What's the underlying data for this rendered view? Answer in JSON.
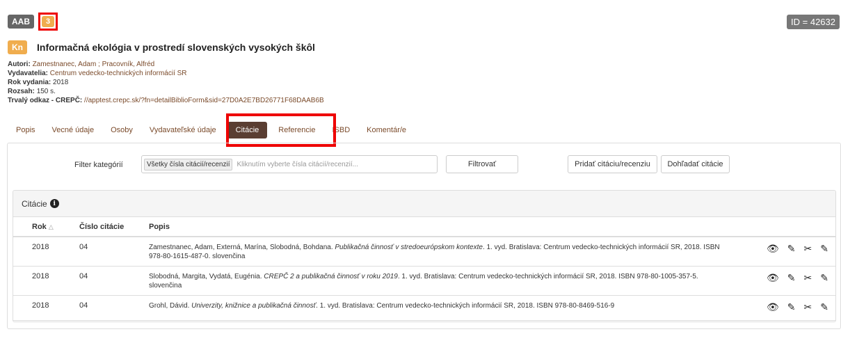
{
  "header": {
    "code_badge": "AAB",
    "count_badge": "3",
    "id_label": "ID = 42632",
    "type_badge": "Kn",
    "title": "Informačná ekológia v prostredí slovenských vysokých škôl"
  },
  "meta": {
    "authors_label": "Autori:",
    "authors": "Zamestnanec, Adam ; Pracovník, Alfréd",
    "publishers_label": "Vydavatelia:",
    "publishers": "Centrum vedecko-technických informácií SR",
    "year_label": "Rok vydania:",
    "year": "2018",
    "extent_label": "Rozsah:",
    "extent": "150 s.",
    "link_label": "Trvalý odkaz - CREPČ:",
    "link": "//apptest.crepc.sk/?fn=detailBiblioForm&sid=27D0A2E7BD26771F68DAAB6B"
  },
  "tabs": [
    {
      "label": "Popis"
    },
    {
      "label": "Vecné údaje"
    },
    {
      "label": "Osoby"
    },
    {
      "label": "Vydavateľské údaje"
    },
    {
      "label": "Citácie"
    },
    {
      "label": "Referencie"
    },
    {
      "label": "ISBD"
    },
    {
      "label": "Komentár/e"
    }
  ],
  "filter": {
    "label": "Filter kategórií",
    "chip": "Všetky čísla citácií/recenzií",
    "placeholder": "Kliknutím vyberte čísla citácií/recenzií...",
    "filter_button": "Filtrovať",
    "add_button": "Pridať citáciu/recenziu",
    "find_button": "Dohľadať citácie"
  },
  "citations": {
    "header": "Citácie",
    "columns": {
      "year": "Rok",
      "number": "Číslo citácie",
      "description": "Popis"
    },
    "rows": [
      {
        "year": "2018",
        "number": "04",
        "desc_pre": "Zamestnanec, Adam, Externá, Marína, Slobodná, Bohdana. ",
        "desc_title": "Publikačná činnosť v stredoeurópskom kontexte",
        "desc_post": ". 1. vyd. Bratislava: Centrum vedecko-technických informácií SR, 2018. ISBN 978-80-1615-487-0. slovenčina"
      },
      {
        "year": "2018",
        "number": "04",
        "desc_pre": "Slobodná, Margita, Vydatá, Eugénia. ",
        "desc_title": "CREPČ 2 a publikačná činnosť v roku 2019",
        "desc_post": ". 1. vyd. Bratislava: Centrum vedecko-technických informácií SR, 2018. ISBN 978-80-1005-357-5. slovenčina"
      },
      {
        "year": "2018",
        "number": "04",
        "desc_pre": "Grohl, Dávid. ",
        "desc_title": "Univerzity, knižnice a publikačná činnosť",
        "desc_post": ". 1. vyd. Bratislava: Centrum vedecko-technických informácií SR, 2018. ISBN 978-80-8469-516-9"
      }
    ]
  },
  "icons": {
    "view": "eye-icon",
    "edit": "pencil-icon",
    "unlink": "unlink-icon",
    "edit_note": "edit-note-icon"
  },
  "colors": {
    "accent_orange": "#f0ad4e",
    "active_tab": "#5a3e32",
    "highlight_red": "#e00000",
    "link_brown": "#7a4a2a"
  }
}
